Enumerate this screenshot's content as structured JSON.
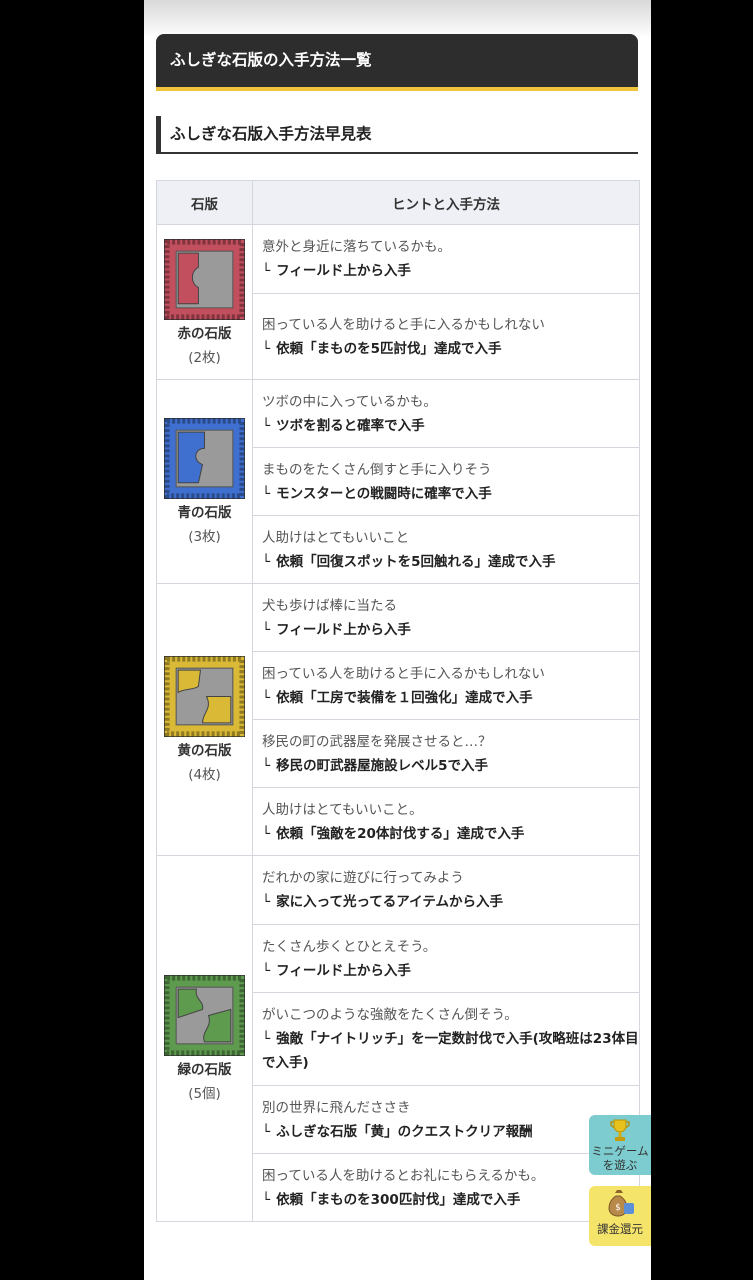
{
  "heading_main": "ふしぎな石版の入手方法一覧",
  "heading_sub": "ふしぎな石版入手方法早見表",
  "table": {
    "col_stone": "石版",
    "col_hint": "ヒントと入手方法",
    "groups": [
      {
        "name": "赤の石版",
        "count": "(2枚)",
        "color": "#c24f5e",
        "rows": [
          {
            "hint": "意外と身近に落ちているかも。",
            "method": "フィールド上から入手"
          },
          {
            "hint": "困っている人を助けると手に入るかもしれない",
            "method": "依頼「まものを5匹討伐」達成で入手"
          }
        ]
      },
      {
        "name": "青の石版",
        "count": "(3枚)",
        "color": "#3f6fcf",
        "rows": [
          {
            "hint": "ツボの中に入っているかも。",
            "method": "ツボを割ると確率で入手"
          },
          {
            "hint": "まものをたくさん倒すと手に入りそう",
            "method": "モンスターとの戦闘時に確率で入手"
          },
          {
            "hint": "人助けはとてもいいこと",
            "method": "依頼「回復スポットを5回触れる」達成で入手"
          }
        ]
      },
      {
        "name": "黄の石版",
        "count": "(4枚)",
        "color": "#d9b935",
        "rows": [
          {
            "hint": "犬も歩けば棒に当たる",
            "method": "フィールド上から入手"
          },
          {
            "hint": "困っている人を助けると手に入るかもしれない",
            "method": "依頼「工房で装備を１回強化」達成で入手"
          },
          {
            "hint": "移民の町の武器屋を発展させると…？",
            "method": "移民の町武器屋施設レベル5で入手"
          },
          {
            "hint": "人助けはとてもいいこと。",
            "method": "依頼「強敵を20体討伐する」達成で入手"
          }
        ]
      },
      {
        "name": "緑の石版",
        "count": "(5個)",
        "color": "#5e9b4f",
        "rows": [
          {
            "hint": "だれかの家に遊びに行ってみよう",
            "method": "家に入って光ってるアイテムから入手"
          },
          {
            "hint": "たくさん歩くとひとえそう。",
            "method": "フィールド上から入手"
          },
          {
            "hint": "がいこつのような強敵をたくさん倒そう。",
            "method": "強敵「ナイトリッチ」を一定数討伐で入手(攻略班は23体目で入手)"
          },
          {
            "hint": "別の世界に飛んだささき",
            "method": "ふしぎな石版「黄」のクエストクリア報酬"
          },
          {
            "hint": "困っている人を助けるとお礼にもらえるかも。",
            "method": "依頼「まものを300匹討伐」達成で入手"
          }
        ]
      }
    ]
  },
  "fab_minigame": {
    "line1": "ミニゲーム",
    "line2": "を遊ぶ",
    "icon": "trophy-icon"
  },
  "fab_refund": {
    "label": "課金還元",
    "icon": "money-bag-icon"
  }
}
